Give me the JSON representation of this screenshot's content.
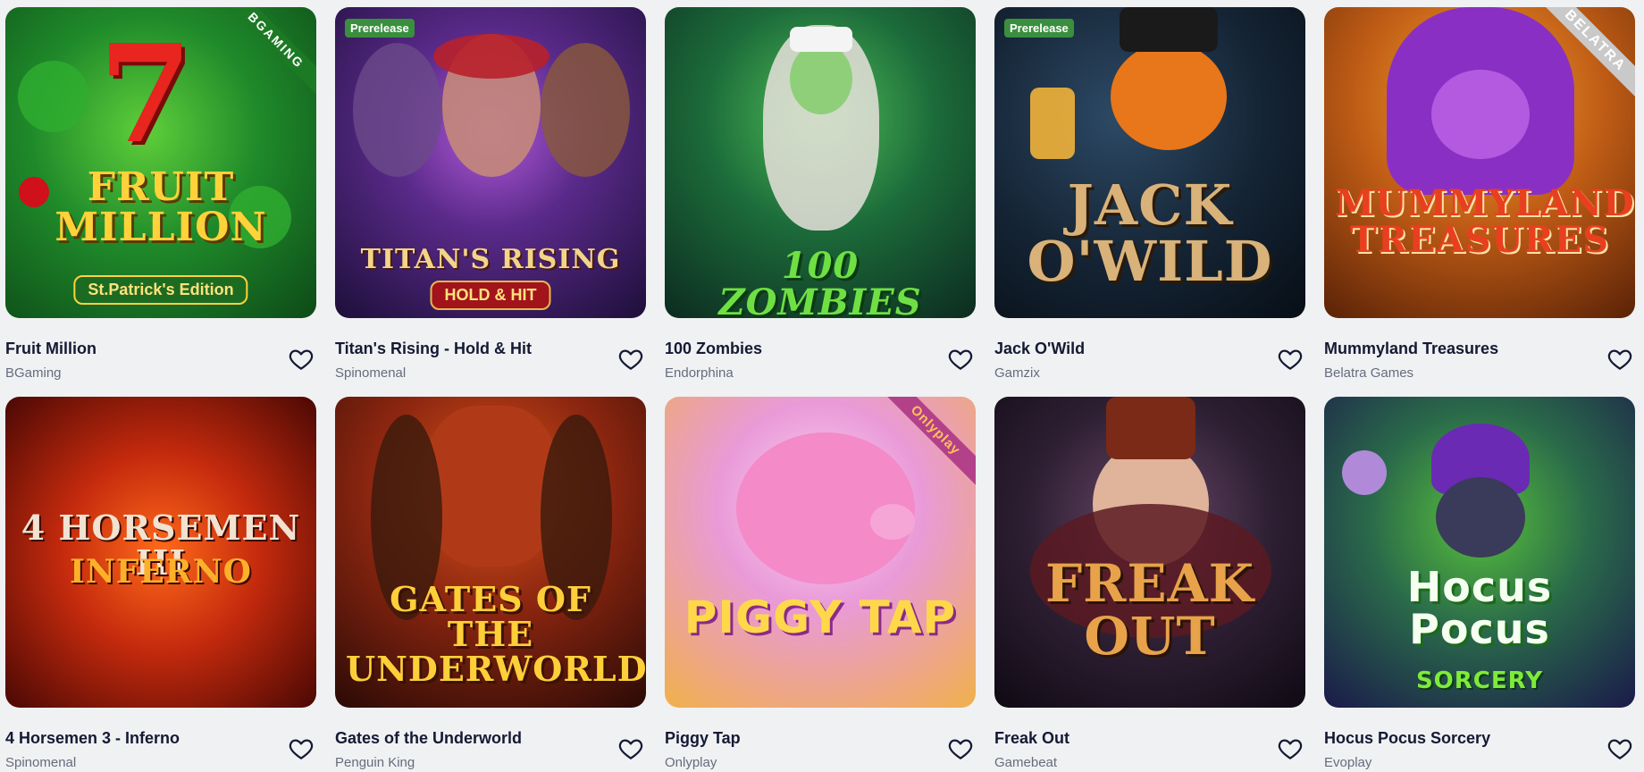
{
  "colors": {
    "page_background": "#f0f1f3",
    "title_text": "#141a33",
    "provider_text": "#666c7d",
    "prerelease_badge": "#3a8f3f"
  },
  "games": [
    {
      "name": "Fruit Million",
      "provider": "BGaming",
      "art": {
        "title": "FRUIT MILLION",
        "subtitle": "St.Patrick's Edition",
        "brand": "BGAMING"
      },
      "badge": ""
    },
    {
      "name": "Titan's Rising - Hold & Hit",
      "provider": "Spinomenal",
      "art": {
        "title": "TITAN'S RISING",
        "subtitle": "HOLD & HIT",
        "brand": ""
      },
      "badge": "Prerelease"
    },
    {
      "name": "100 Zombies",
      "provider": "Endorphina",
      "art": {
        "title": "100 ZOMBIES",
        "subtitle": "",
        "brand": ""
      },
      "badge": ""
    },
    {
      "name": "Jack O'Wild",
      "provider": "Gamzix",
      "art": {
        "title": "JACK O'WILD",
        "subtitle": "",
        "brand": ""
      },
      "badge": "Prerelease"
    },
    {
      "name": "Mummyland Treasures",
      "provider": "Belatra Games",
      "art": {
        "title": "MUMMYLAND TREASURES",
        "subtitle": "",
        "brand": "BELATRA"
      },
      "badge": ""
    },
    {
      "name": "4 Horsemen 3 - Inferno",
      "provider": "Spinomenal",
      "art": {
        "title": "4 HORSEMEN III",
        "subtitle": "INFERNO",
        "brand": ""
      },
      "badge": ""
    },
    {
      "name": "Gates of the Underworld",
      "provider": "Penguin King",
      "art": {
        "title": "GATES OF THE UNDERWORLD",
        "subtitle": "",
        "brand": ""
      },
      "badge": ""
    },
    {
      "name": "Piggy Tap",
      "provider": "Onlyplay",
      "art": {
        "title": "PIGGY TAP",
        "subtitle": "",
        "brand": "Onlyplay"
      },
      "badge": ""
    },
    {
      "name": "Freak Out",
      "provider": "Gamebeat",
      "art": {
        "title": "FREAK OUT",
        "subtitle": "",
        "brand": ""
      },
      "badge": ""
    },
    {
      "name": "Hocus Pocus Sorcery",
      "provider": "Evoplay",
      "art": {
        "title": "Hocus Pocus",
        "subtitle": "SORCERY",
        "brand": ""
      },
      "badge": ""
    }
  ],
  "icons": {
    "favorite": "heart-outline-icon"
  }
}
